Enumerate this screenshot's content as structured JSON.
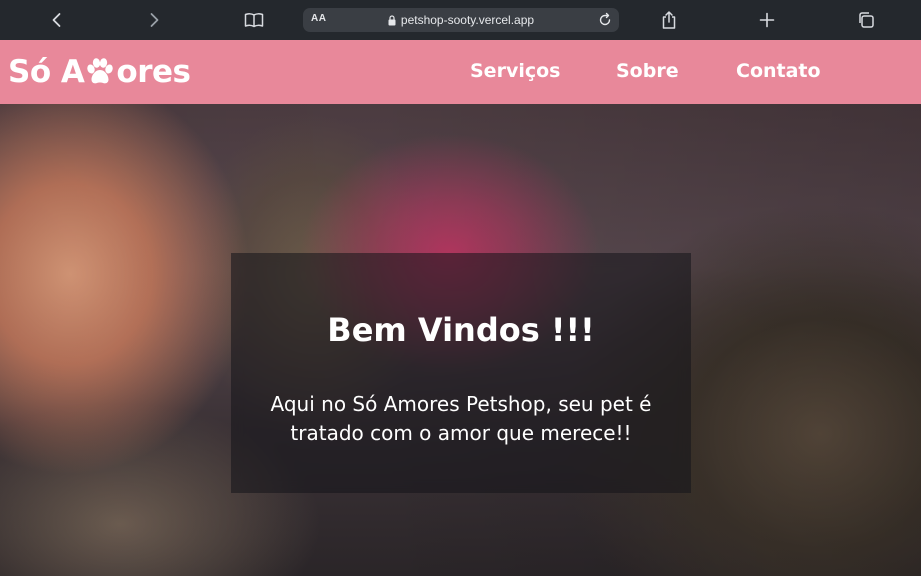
{
  "browser": {
    "text_size_label": "AA",
    "url": "petshop-sooty.vercel.app"
  },
  "navbar": {
    "logo_left": "Só A",
    "logo_right": "ores",
    "links": [
      "Serviços",
      "Sobre",
      "Contato"
    ],
    "color": "#e8889a"
  },
  "hero": {
    "title": "Bem Vindos !!!",
    "text": "Aqui no Só Amores Petshop, seu pet é tratado com o amor que merece!!"
  },
  "icons": {
    "back": "chevron-left-icon",
    "forward": "chevron-right-icon",
    "bookmarks": "book-icon",
    "lock": "lock-icon",
    "reload": "reload-icon",
    "share": "share-icon",
    "new_tab": "plus-icon",
    "tabs": "tabs-icon",
    "logo_paw": "paw-icon"
  }
}
